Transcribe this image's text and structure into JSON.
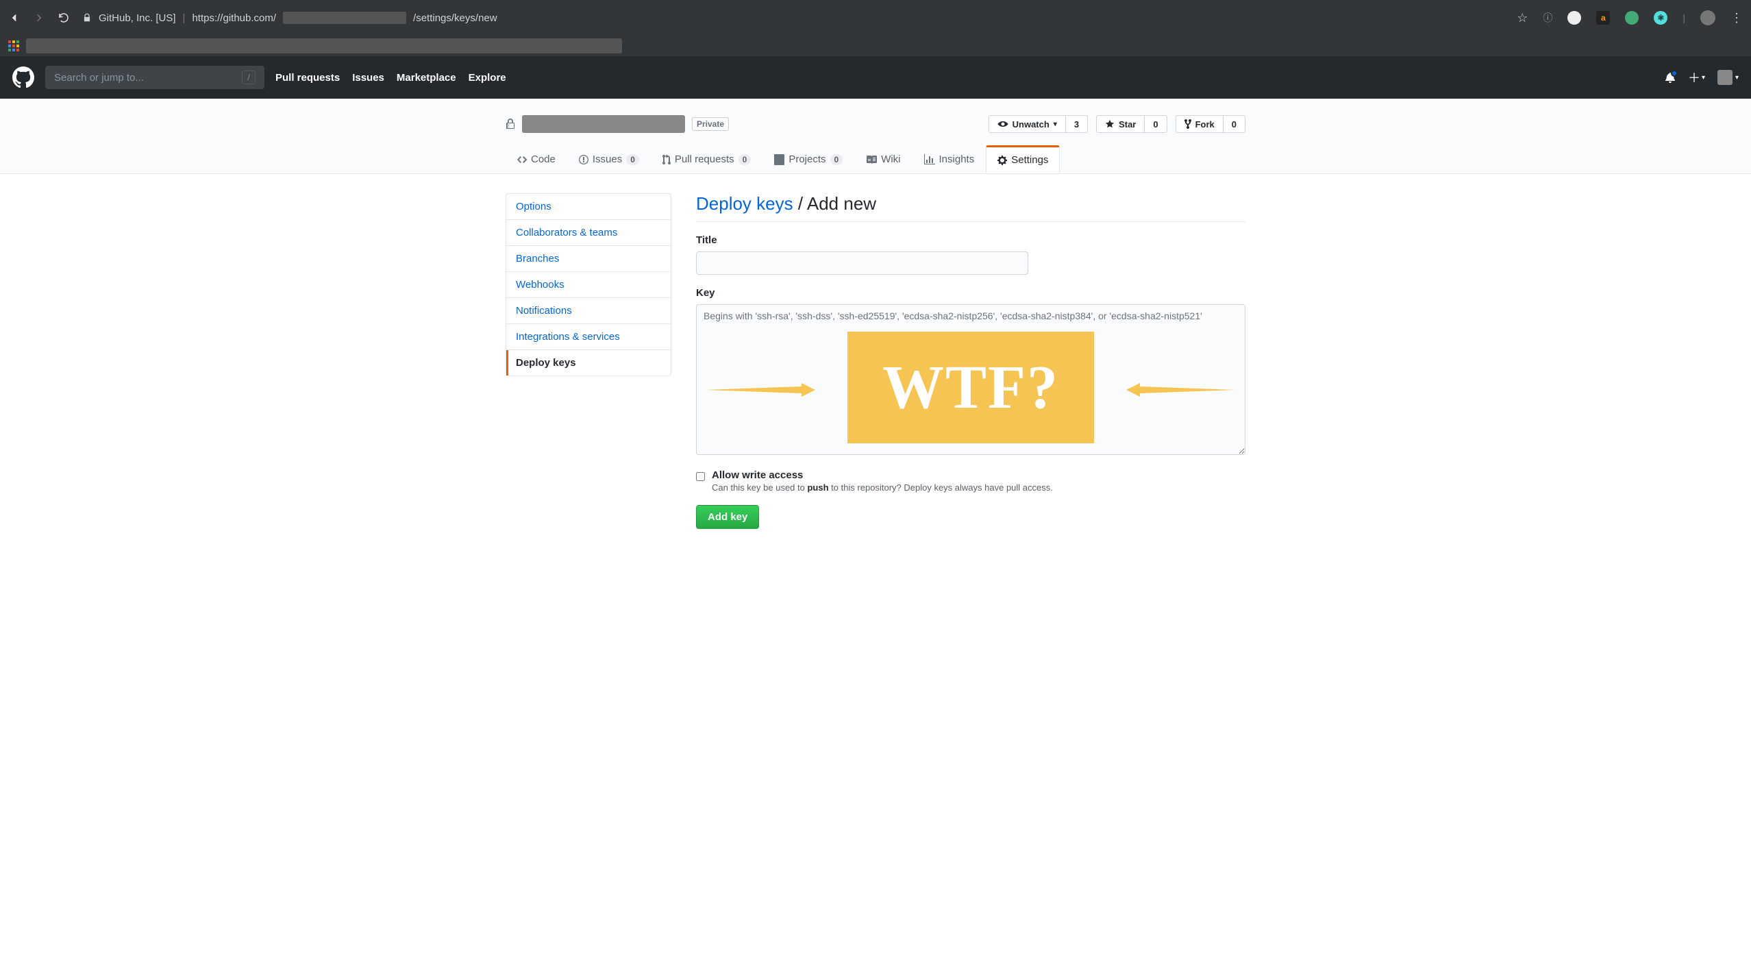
{
  "browser": {
    "url_prefix": "GitHub, Inc. [US]",
    "url_visible_left": "https://github.com/",
    "url_visible_right": "/settings/keys/new"
  },
  "header": {
    "search_placeholder": "Search or jump to...",
    "nav": {
      "pull_requests": "Pull requests",
      "issues": "Issues",
      "marketplace": "Marketplace",
      "explore": "Explore"
    }
  },
  "repo": {
    "private_label": "Private",
    "actions": {
      "unwatch": {
        "label": "Unwatch",
        "count": "3"
      },
      "star": {
        "label": "Star",
        "count": "0"
      },
      "fork": {
        "label": "Fork",
        "count": "0"
      }
    },
    "tabs": {
      "code": "Code",
      "issues": {
        "label": "Issues",
        "count": "0"
      },
      "pull_requests": {
        "label": "Pull requests",
        "count": "0"
      },
      "projects": {
        "label": "Projects",
        "count": "0"
      },
      "wiki": "Wiki",
      "insights": "Insights",
      "settings": "Settings"
    }
  },
  "sidebar": {
    "items": [
      "Options",
      "Collaborators & teams",
      "Branches",
      "Webhooks",
      "Notifications",
      "Integrations & services",
      "Deploy keys"
    ]
  },
  "page": {
    "breadcrumb_link": "Deploy keys",
    "breadcrumb_sep": " / ",
    "breadcrumb_current": "Add new",
    "title_label": "Title",
    "key_label": "Key",
    "key_placeholder": "Begins with 'ssh-rsa', 'ssh-dss', 'ssh-ed25519', 'ecdsa-sha2-nistp256', 'ecdsa-sha2-nistp384', or 'ecdsa-sha2-nistp521'",
    "allow_write_label": "Allow write access",
    "allow_write_note_pre": "Can this key be used to ",
    "allow_write_note_strong": "push",
    "allow_write_note_post": " to this repository? Deploy keys always have pull access.",
    "submit": "Add key"
  },
  "annotation": {
    "wtf": "WTF?"
  }
}
